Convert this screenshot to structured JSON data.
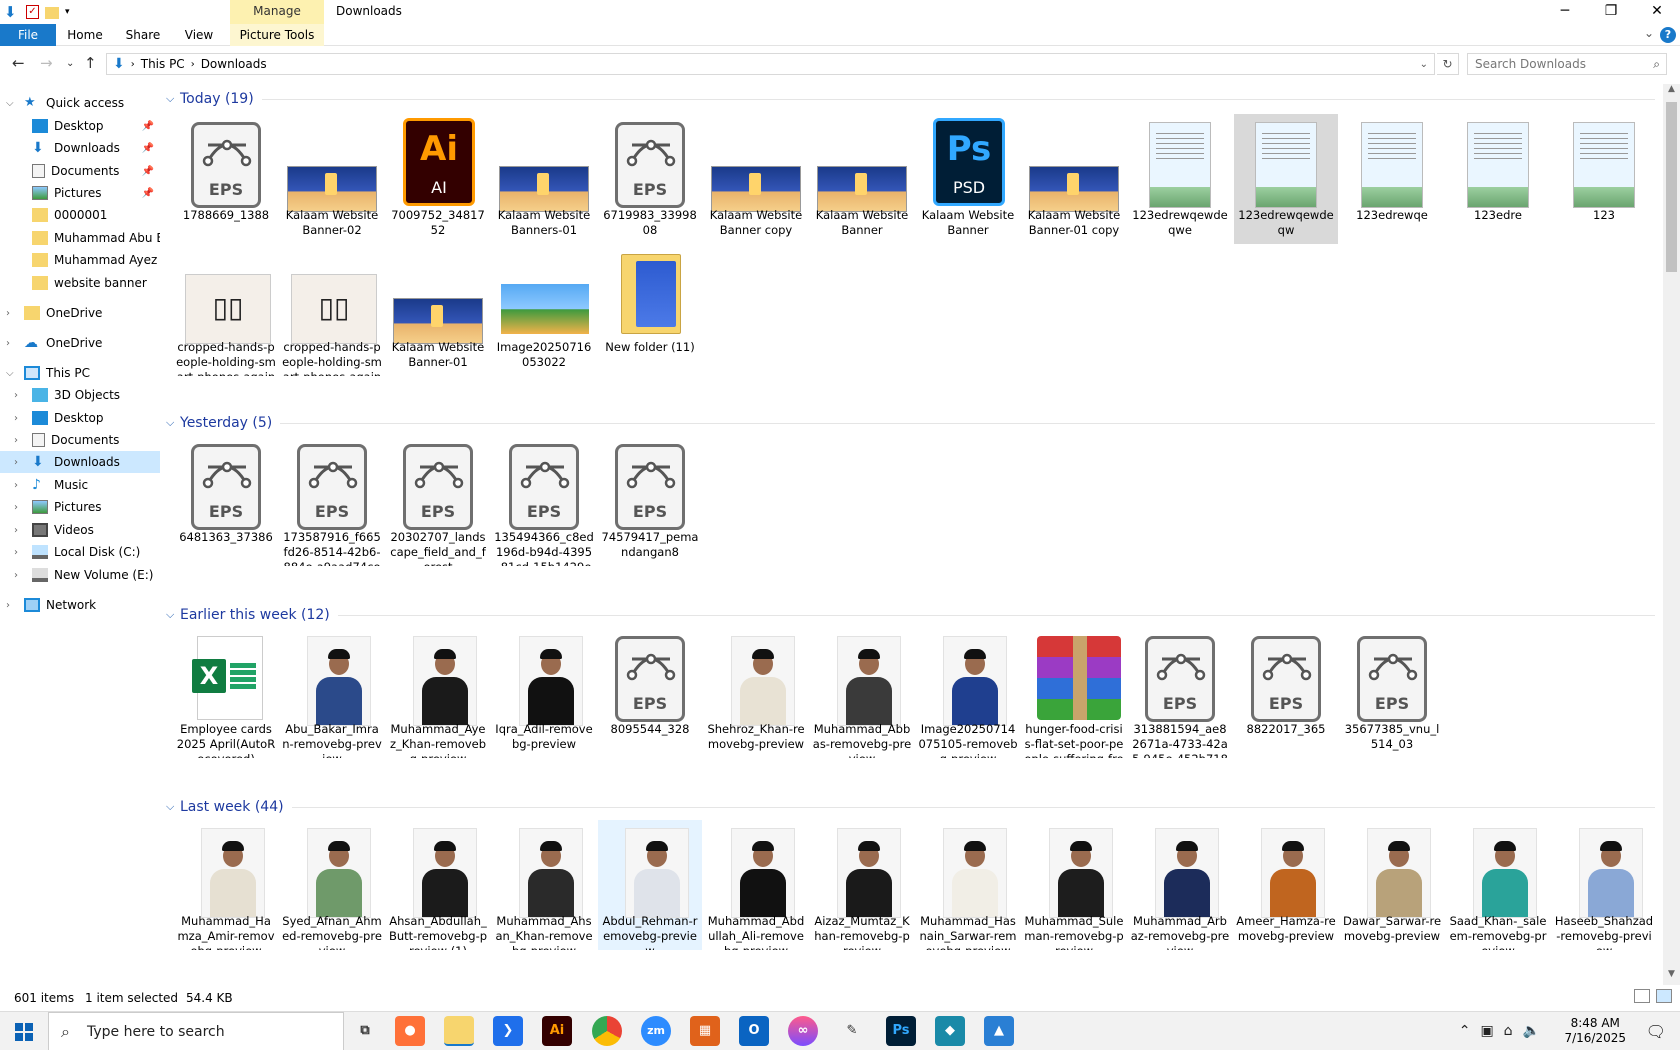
{
  "window": {
    "title": "Downloads",
    "manage_tab": "Manage",
    "ribbon_tabs": [
      "File",
      "Home",
      "Share",
      "View",
      "Picture Tools"
    ],
    "controls": {
      "minimize": "─",
      "restore": "❐",
      "close": "✕"
    }
  },
  "addressbar": {
    "path": [
      "This PC",
      "Downloads"
    ],
    "search_placeholder": "Search Downloads"
  },
  "nav": {
    "quick_access": "Quick access",
    "pinned": [
      "Desktop",
      "Downloads",
      "Documents",
      "Pictures"
    ],
    "folders": [
      "0000001",
      "Muhammad Abu Ba",
      "Muhammad Ayez K",
      "website banner"
    ],
    "onedrive_personal": "OneDrive",
    "onedrive": "OneDrive",
    "this_pc": "This PC",
    "pc_items": [
      "3D Objects",
      "Desktop",
      "Documents",
      "Downloads",
      "Music",
      "Pictures",
      "Videos",
      "Local Disk (C:)",
      "New Volume (E:)"
    ],
    "network": "Network"
  },
  "groups": [
    {
      "label": "Today (19)",
      "files": [
        {
          "name": "1788669_1388",
          "kind": "eps"
        },
        {
          "name": "Kalaam Website Banner-02",
          "kind": "banner"
        },
        {
          "name": "7009752_3481752",
          "kind": "ai"
        },
        {
          "name": "Kalaam Website Banners-01",
          "kind": "banner"
        },
        {
          "name": "6719983_3399808",
          "kind": "eps"
        },
        {
          "name": "Kalaam Website Banner copy",
          "kind": "banner"
        },
        {
          "name": "Kalaam Website Banner",
          "kind": "banner"
        },
        {
          "name": "Kalaam Website Banner",
          "kind": "psd"
        },
        {
          "name": "Kalaam Website Banner-01 copy",
          "kind": "banner"
        },
        {
          "name": "123edrewqewdeqwe",
          "kind": "doc"
        },
        {
          "name": "123edrewqewdeqw",
          "kind": "doc",
          "selected": true
        },
        {
          "name": "123edrewqe",
          "kind": "doc"
        },
        {
          "name": "123edre",
          "kind": "doc"
        },
        {
          "name": "123",
          "kind": "doc"
        },
        {
          "name": "cropped-hands-people-holding-smart-phones-against-white-bac...",
          "kind": "phones"
        },
        {
          "name": "cropped-hands-people-holding-smart-phones-against-white-bac...",
          "kind": "phones"
        },
        {
          "name": "Kalaam Website Banner-01",
          "kind": "banner"
        },
        {
          "name": "Image20250716053022",
          "kind": "landscape"
        },
        {
          "name": "New folder (11)",
          "kind": "folder"
        }
      ]
    },
    {
      "label": "Yesterday (5)",
      "files": [
        {
          "name": "6481363_37386",
          "kind": "eps"
        },
        {
          "name": "173587916_f665fd26-8514-42b6-884e-a9aad74cea41",
          "kind": "eps"
        },
        {
          "name": "20302707_landscape_field_and_forest",
          "kind": "eps"
        },
        {
          "name": "135494366_c8ed196d-b94d-4395-81cd-15b1429e3d63",
          "kind": "eps"
        },
        {
          "name": "74579417_pemandangan8",
          "kind": "eps"
        }
      ]
    },
    {
      "label": "Earlier this week (12)",
      "files": [
        {
          "name": "Employee cards 2025 April(AutoRecovered)",
          "kind": "excel"
        },
        {
          "name": "Abu_Bakar_Imran-removebg-preview",
          "kind": "photo",
          "color": "#2b4a8a"
        },
        {
          "name": "Muhammad_Ayez_Khan-removebg-preview",
          "kind": "photo",
          "color": "#1a1a1a"
        },
        {
          "name": "Iqra_Adil-removebg-preview",
          "kind": "photo",
          "color": "#111111"
        },
        {
          "name": "8095544_328",
          "kind": "eps"
        },
        {
          "name": "Shehroz_Khan-removebg-preview",
          "kind": "photo",
          "color": "#e8e2d4"
        },
        {
          "name": "Muhammad_Abbas-removebg-preview",
          "kind": "photo",
          "color": "#3a3a3a"
        },
        {
          "name": "Image20250714075105-removebg-preview",
          "kind": "photo",
          "color": "#1f3f8f"
        },
        {
          "name": "hunger-food-crisis-flat-set-poor-people-suffering-from-lack-nutrit...",
          "kind": "rar"
        },
        {
          "name": "313881594_ae82671a-4733-42a5-945e-452b71850fdc",
          "kind": "eps"
        },
        {
          "name": "8822017_365",
          "kind": "eps"
        },
        {
          "name": "35677385_vnu_l514_03",
          "kind": "eps"
        }
      ]
    },
    {
      "label": "Last week (44)",
      "files": [
        {
          "name": "Muhammad_Hamza_Amir-removebg-preview",
          "kind": "photo",
          "color": "#e6e0d2"
        },
        {
          "name": "Syed_Afnan_Ahmed-removebg-preview",
          "kind": "photo",
          "color": "#6f9a6a"
        },
        {
          "name": "Ahsan_Abdullah_Butt-removebg-preview (1)",
          "kind": "photo",
          "color": "#1b1b1b"
        },
        {
          "name": "Muhammad_Ahsan_Khan-removebg-preview",
          "kind": "photo",
          "color": "#2a2a2a"
        },
        {
          "name": "Abdul_Rehman-removebg-preview",
          "kind": "photo",
          "color": "#dfe3ea",
          "hover": true
        },
        {
          "name": "Muhammad_Abdullah_Ali-removebg-preview",
          "kind": "photo",
          "color": "#111111"
        },
        {
          "name": "Aizaz_Mumtaz_Khan-removebg-preview",
          "kind": "photo",
          "color": "#1a1a1a"
        },
        {
          "name": "Muhammad_Hasnain_Sarwar-removebg-preview",
          "kind": "photo",
          "color": "#f1eee6"
        },
        {
          "name": "Muhammad_Suleman-removebg-preview",
          "kind": "photo",
          "color": "#1d1d1d"
        },
        {
          "name": "Muhammad_Arbaz-removebg-preview",
          "kind": "photo",
          "color": "#1c2c5a"
        },
        {
          "name": "Ameer_Hamza-removebg-preview",
          "kind": "photo",
          "color": "#c0651f"
        },
        {
          "name": "Dawar_Sarwar-removebg-preview",
          "kind": "photo",
          "color": "#b8a27a"
        },
        {
          "name": "Saad_Khan-_saleem-removebg-preview",
          "kind": "photo",
          "color": "#2aa39a"
        },
        {
          "name": "Haseeb_Shahzad-removebg-preview",
          "kind": "photo",
          "color": "#8aa8d6"
        }
      ]
    }
  ],
  "status": {
    "items": "601 items",
    "selected": "1 item selected",
    "size": "54.4 KB"
  },
  "taskbar": {
    "search_placeholder": "Type here to search",
    "apps": [
      "firefox",
      "file-explorer",
      "vscode",
      "illustrator",
      "chrome",
      "zoom",
      "ms-office-app",
      "outlook",
      "creative-cloud",
      "pen-tool",
      "photoshop",
      "app-diamond",
      "photos"
    ],
    "time": "8:48 AM",
    "date": "7/16/2025"
  },
  "colors": {
    "accent": "#1979ca",
    "group_header": "#1e3aa0",
    "selected_nav": "#cce8ff",
    "manage_tab": "#fdf1b0"
  }
}
